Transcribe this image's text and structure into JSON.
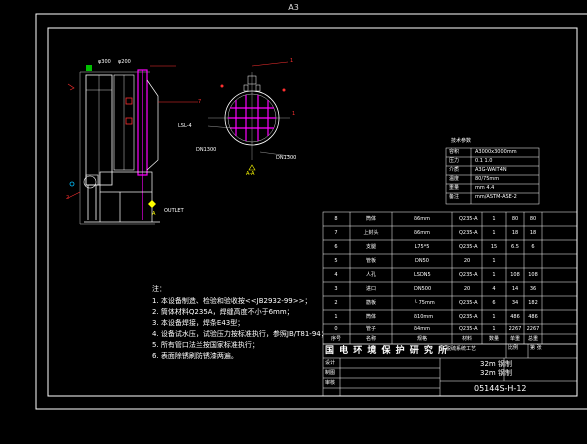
{
  "sheet_title": "A3",
  "colors": {
    "background": "#000000",
    "frame": "#ffffff",
    "vessel": "#ffffff",
    "pipe": "#ff00ff",
    "accent_red": "#ff3030",
    "dimension": "#c0c0c0",
    "yellow": "#ffff00"
  },
  "front_view": {
    "dims": [
      "φ300",
      "φ200"
    ],
    "leaders": [
      "1",
      "2",
      "7"
    ],
    "callouts": [
      "LSL-4",
      "OUTLET"
    ],
    "label": "A"
  },
  "section_view": {
    "dims": [
      "DN1300",
      "DN1300"
    ],
    "label": "A-A",
    "marker": "1"
  },
  "spec_table": {
    "title": "技术参数",
    "rows": [
      [
        "容积",
        "A3000x3000mm"
      ],
      [
        "压力",
        "0.1 1.0"
      ],
      [
        "介质",
        "A3G-WAIT4N"
      ],
      [
        "温度",
        "80/75mm"
      ],
      [
        "重量",
        "mm 4.4"
      ],
      [
        "备注",
        "mm/ASTM-ASE-2"
      ]
    ]
  },
  "bom": {
    "rows": [
      [
        "8",
        "筒体",
        "δ6mm",
        "Q235-A",
        "1",
        "80",
        "80"
      ],
      [
        "7",
        "上封头",
        "δ6mm",
        "Q235-A",
        "1",
        "18",
        "18"
      ],
      [
        "6",
        "支腿",
        "L75*5",
        "Q235-A",
        "15",
        "6.5",
        "6"
      ],
      [
        "5",
        "管板",
        "DN50",
        "20",
        "1",
        "",
        ""
      ],
      [
        "4",
        "人孔",
        "LSDN5",
        "Q235-A",
        "1",
        "108",
        "108"
      ],
      [
        "3",
        "进口",
        "DN500",
        "20",
        "4",
        "14",
        "36"
      ],
      [
        "2",
        "筋板",
        "└ 75mm",
        "Q235-A",
        "6",
        "34",
        "182"
      ],
      [
        "1",
        "筒体",
        "δ10mm",
        "Q235-A",
        "1",
        "486",
        "486"
      ],
      [
        "0",
        "管子",
        "δ4mm",
        "Q235-A",
        "1",
        "2267",
        "2267"
      ]
    ],
    "header": [
      "序号",
      "名称",
      "规格",
      "材料",
      "数量",
      "单重",
      "总重"
    ]
  },
  "notes": {
    "title": "注：",
    "lines": [
      "1. 本设备制造、检验和验收按<<JB2932-99>>；",
      "2. 筒体材料Q235A，焊缝高度不小于6mm；",
      "3. 本设备焊接，焊条E43型；",
      "4. 设备试水压，试验压力按标准执行，参照JB/T81-94；",
      "5. 所有管口法兰按国家标准执行；",
      "6. 表面除锈刷防锈漆两遍。"
    ]
  },
  "title_block": {
    "org": "国 电 环 境 保 护 研 究 所",
    "sub": "脱硫系统工艺",
    "product_line1": "32m 钢制",
    "product_line2": "32m 钢制",
    "drawing_no": "05144S-H-12",
    "roles": [
      "设计",
      "制图",
      "审核"
    ],
    "scale_label": "比例",
    "sheet_label": "第 张"
  }
}
